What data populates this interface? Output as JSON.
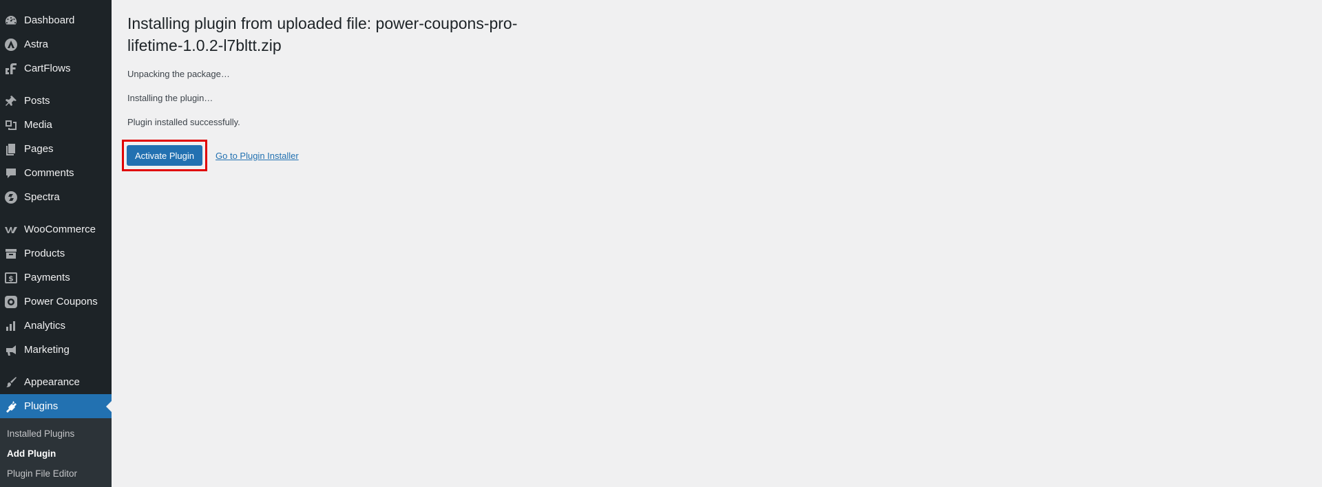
{
  "sidebar": {
    "items": [
      {
        "label": "Dashboard",
        "icon": "dashboard-icon"
      },
      {
        "label": "Astra",
        "icon": "astra-icon"
      },
      {
        "label": "CartFlows",
        "icon": "cartflows-icon"
      },
      {
        "label": "Posts",
        "icon": "pin-icon"
      },
      {
        "label": "Media",
        "icon": "media-icon"
      },
      {
        "label": "Pages",
        "icon": "pages-icon"
      },
      {
        "label": "Comments",
        "icon": "comment-icon"
      },
      {
        "label": "Spectra",
        "icon": "spectra-icon"
      },
      {
        "label": "WooCommerce",
        "icon": "woocommerce-icon"
      },
      {
        "label": "Products",
        "icon": "archive-icon"
      },
      {
        "label": "Payments",
        "icon": "dollar-icon"
      },
      {
        "label": "Power Coupons",
        "icon": "coupon-icon"
      },
      {
        "label": "Analytics",
        "icon": "bar-chart-icon"
      },
      {
        "label": "Marketing",
        "icon": "megaphone-icon"
      },
      {
        "label": "Appearance",
        "icon": "paintbrush-icon"
      },
      {
        "label": "Plugins",
        "icon": "plug-icon",
        "active": true
      }
    ],
    "submenu": [
      {
        "label": "Installed Plugins"
      },
      {
        "label": "Add Plugin",
        "current": true
      },
      {
        "label": "Plugin File Editor"
      }
    ]
  },
  "main": {
    "heading": "Installing plugin from uploaded file: power-coupons-pro-lifetime-1.0.2-l7bltt.zip",
    "log": [
      "Unpacking the package…",
      "Installing the plugin…",
      "Plugin installed successfully."
    ],
    "activate_label": "Activate Plugin",
    "installer_link": "Go to Plugin Installer"
  },
  "colors": {
    "sidebar_bg": "#1d2327",
    "accent": "#2271b1",
    "highlight": "#e00000",
    "page_bg": "#f0f0f1"
  }
}
